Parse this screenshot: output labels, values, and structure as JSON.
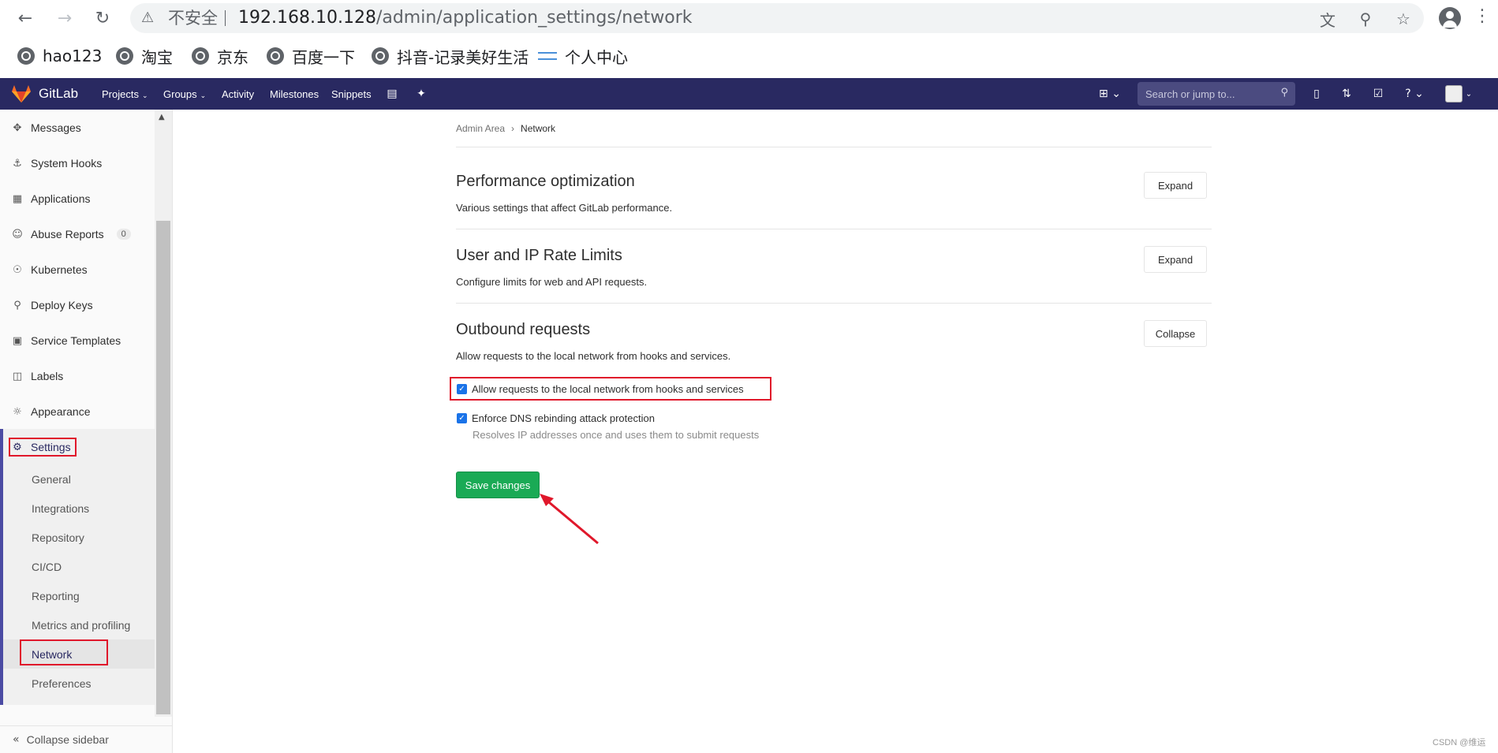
{
  "browser": {
    "insecure_label": "不安全",
    "url_host": "192.168.10.128",
    "url_path": "/admin/application_settings/network",
    "bookmarks": [
      "hao123",
      "淘宝",
      "京东",
      "百度一下",
      "抖音-记录美好生活",
      "个人中心"
    ]
  },
  "header": {
    "brand": "GitLab",
    "nav": [
      "Projects",
      "Groups",
      "Activity",
      "Milestones",
      "Snippets"
    ],
    "search_placeholder": "Search or jump to..."
  },
  "sidebar": {
    "items": [
      {
        "label": "Messages",
        "icon": "broadcast-icon"
      },
      {
        "label": "System Hooks",
        "icon": "hook-icon"
      },
      {
        "label": "Applications",
        "icon": "grid-icon"
      },
      {
        "label": "Abuse Reports",
        "icon": "face-icon",
        "badge": "0"
      },
      {
        "label": "Kubernetes",
        "icon": "cluster-icon"
      },
      {
        "label": "Deploy Keys",
        "icon": "key-icon"
      },
      {
        "label": "Service Templates",
        "icon": "template-icon"
      },
      {
        "label": "Labels",
        "icon": "labels-icon"
      },
      {
        "label": "Appearance",
        "icon": "palette-icon"
      },
      {
        "label": "Settings",
        "icon": "gear-icon"
      }
    ],
    "settings_sub": [
      "General",
      "Integrations",
      "Repository",
      "CI/CD",
      "Reporting",
      "Metrics and profiling",
      "Network",
      "Preferences"
    ],
    "collapse_label": "Collapse sidebar"
  },
  "main": {
    "breadcrumb": {
      "parent": "Admin Area",
      "current": "Network"
    },
    "sections": [
      {
        "title": "Performance optimization",
        "desc": "Various settings that affect GitLab performance.",
        "button": "Expand"
      },
      {
        "title": "User and IP Rate Limits",
        "desc": "Configure limits for web and API requests.",
        "button": "Expand"
      },
      {
        "title": "Outbound requests",
        "desc": "Allow requests to the local network from hooks and services.",
        "button": "Collapse"
      }
    ],
    "checkboxes": [
      {
        "label": "Allow requests to the local network from hooks and services",
        "checked": true
      },
      {
        "label": "Enforce DNS rebinding attack protection",
        "checked": true,
        "help": "Resolves IP addresses once and uses them to submit requests"
      }
    ],
    "save_label": "Save changes"
  },
  "watermark": "CSDN @维运",
  "colors": {
    "header": "#292961",
    "save": "#1aaa55",
    "highlight": "#e0182b"
  }
}
